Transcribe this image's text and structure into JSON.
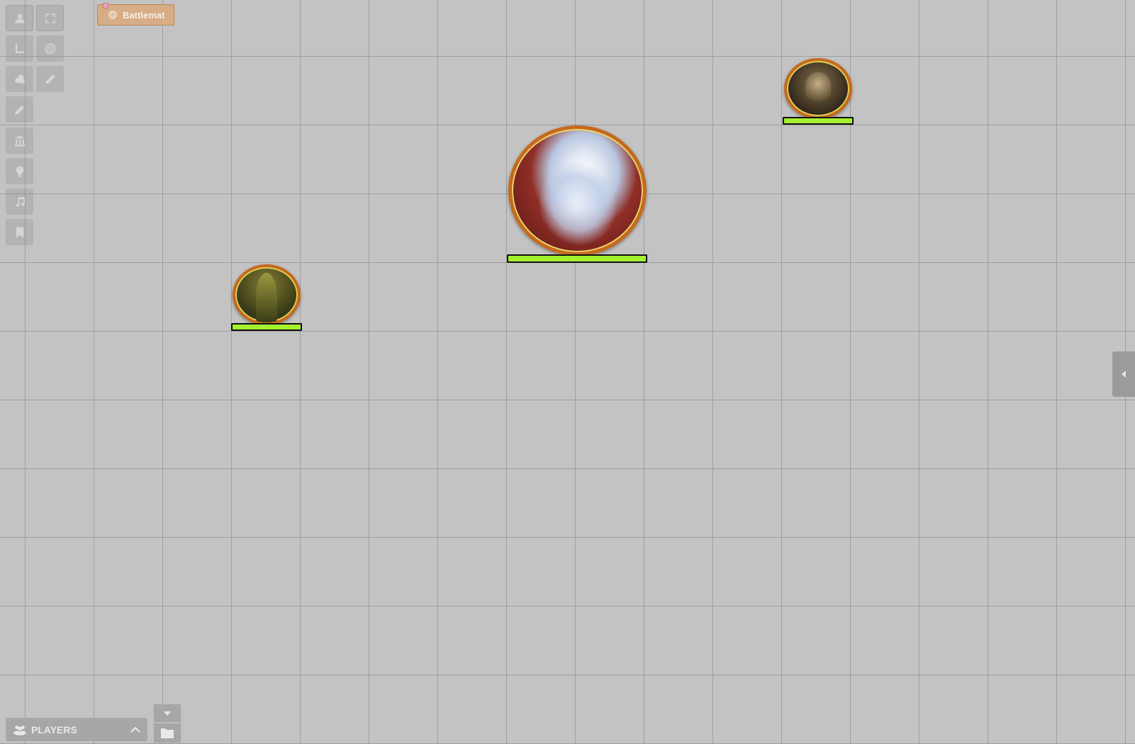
{
  "page_tab": {
    "label": "Battlemat",
    "icon": "target-icon"
  },
  "toolbar": {
    "left_column": [
      {
        "name": "token-icon",
        "tooltip": ""
      },
      {
        "name": "map-layer-icon",
        "tooltip": ""
      },
      {
        "name": "dice-icon",
        "tooltip": ""
      },
      {
        "name": "pencil-icon",
        "tooltip": ""
      },
      {
        "name": "bank-icon",
        "tooltip": ""
      },
      {
        "name": "lightbulb-icon",
        "tooltip": ""
      },
      {
        "name": "music-icon",
        "tooltip": ""
      },
      {
        "name": "bookmark-icon",
        "tooltip": ""
      }
    ],
    "right_column": [
      {
        "name": "fullscreen-icon"
      },
      {
        "name": "target-icon"
      },
      {
        "name": "ruler-icon"
      }
    ]
  },
  "tokens": [
    {
      "name": "monster-token",
      "health_fraction": 1.0
    },
    {
      "name": "spirit-token",
      "health_fraction": 1.0
    },
    {
      "name": "cultist-token",
      "health_fraction": 1.0
    }
  ],
  "players_bar": {
    "label": "PLAYERS",
    "icon": "players-icon",
    "toggle_icon": "chevron-up-icon"
  },
  "side_buttons": {
    "collapse_icon": "caret-down-icon",
    "folder_icon": "folder-icon"
  },
  "right_handle": {
    "icon": "caret-left-icon"
  },
  "colors": {
    "background": "#c3c3c3",
    "grid_line": "#8a8a8a",
    "health_bar": "#a5f12f",
    "token_ring": "#c56a1e",
    "page_tab": "#d6ad86"
  }
}
